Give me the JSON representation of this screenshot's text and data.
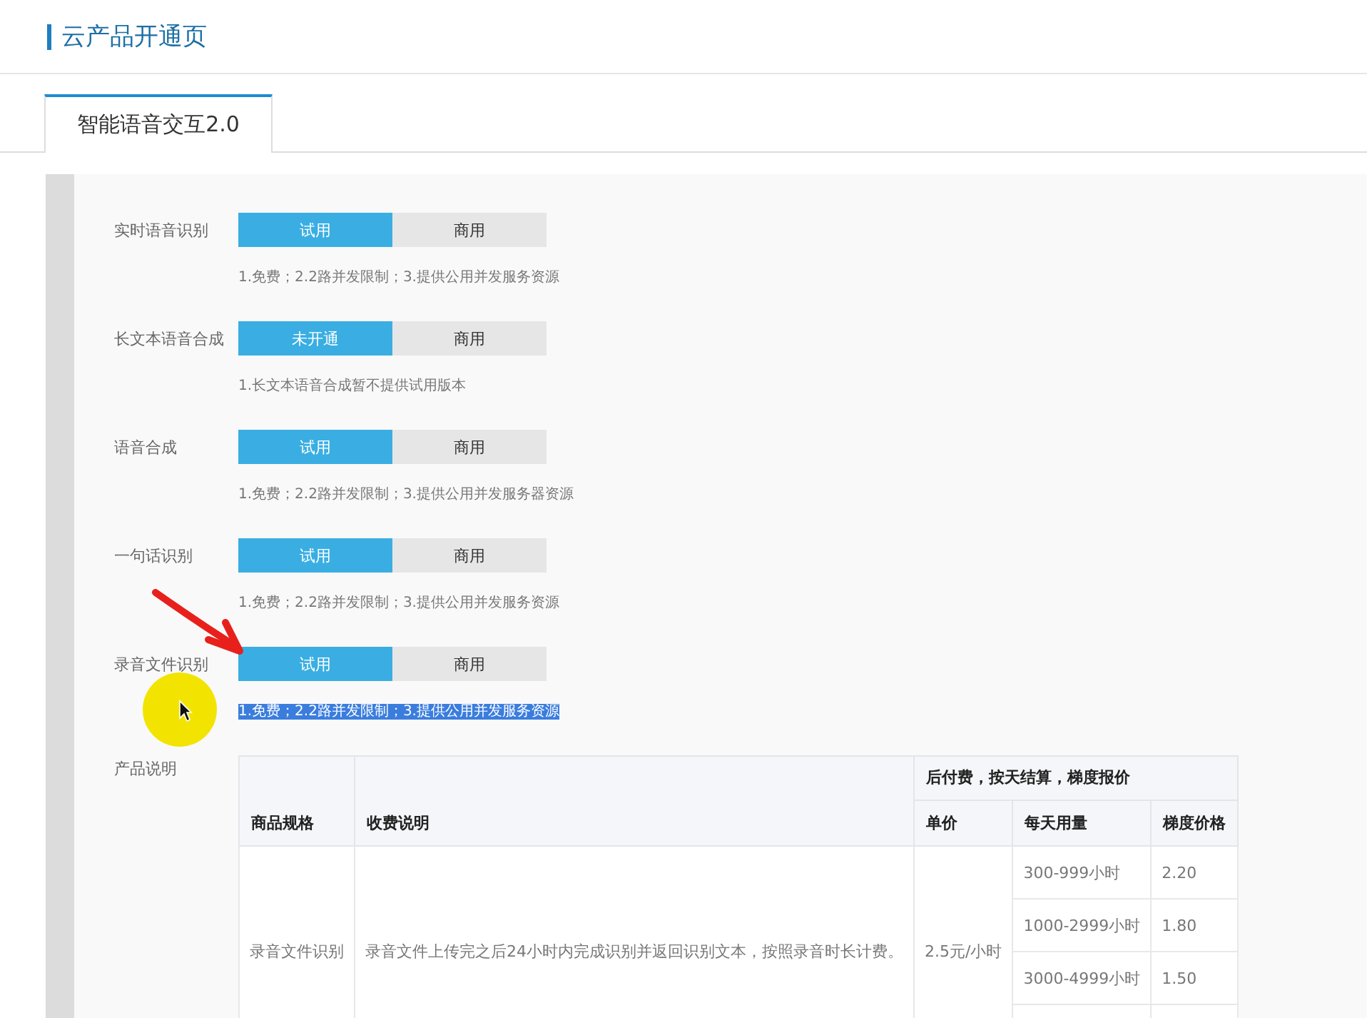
{
  "page_title": "云产品开通页",
  "tabs": [
    {
      "label": "智能语音交互2.0",
      "selected": true
    }
  ],
  "services": [
    {
      "name": "实时语音识别",
      "options": [
        {
          "label": "试用",
          "selected": true
        },
        {
          "label": "商用",
          "selected": false
        }
      ],
      "note": "1.免费；2.2路并发限制；3.提供公用并发服务资源",
      "note_highlighted": false
    },
    {
      "name": "长文本语音合成",
      "options": [
        {
          "label": "未开通",
          "selected": true
        },
        {
          "label": "商用",
          "selected": false
        }
      ],
      "note": "1.长文本语音合成暂不提供试用版本",
      "note_highlighted": false
    },
    {
      "name": "语音合成",
      "options": [
        {
          "label": "试用",
          "selected": true
        },
        {
          "label": "商用",
          "selected": false
        }
      ],
      "note": "1.免费；2.2路并发限制；3.提供公用并发服务器资源",
      "note_highlighted": false
    },
    {
      "name": "一句话识别",
      "options": [
        {
          "label": "试用",
          "selected": true
        },
        {
          "label": "商用",
          "selected": false
        }
      ],
      "note": "1.免费；2.2路并发限制；3.提供公用并发服务资源",
      "note_highlighted": false
    },
    {
      "name": "录音文件识别",
      "options": [
        {
          "label": "试用",
          "selected": true
        },
        {
          "label": "商用",
          "selected": false
        }
      ],
      "note": "1.免费；2.2路并发限制；3.提供公用并发服务资源",
      "note_highlighted": true
    }
  ],
  "product_info": {
    "label": "产品说明",
    "billing_header": "后付费，按天结算，梯度报价",
    "columns": [
      "商品规格",
      "收费说明",
      "单价",
      "每天用量",
      "梯度价格"
    ],
    "row": {
      "spec": "录音文件识别",
      "description": "录音文件上传完之后24小时内完成识别并返回识别文本，按照录音时长计费。",
      "unit_price": "2.5元/小时",
      "tiers": [
        {
          "usage": "300-999小时",
          "price": "2.20"
        },
        {
          "usage": "1000-2999小时",
          "price": "1.80"
        },
        {
          "usage": "3000-4999小时",
          "price": "1.50"
        }
      ]
    }
  }
}
